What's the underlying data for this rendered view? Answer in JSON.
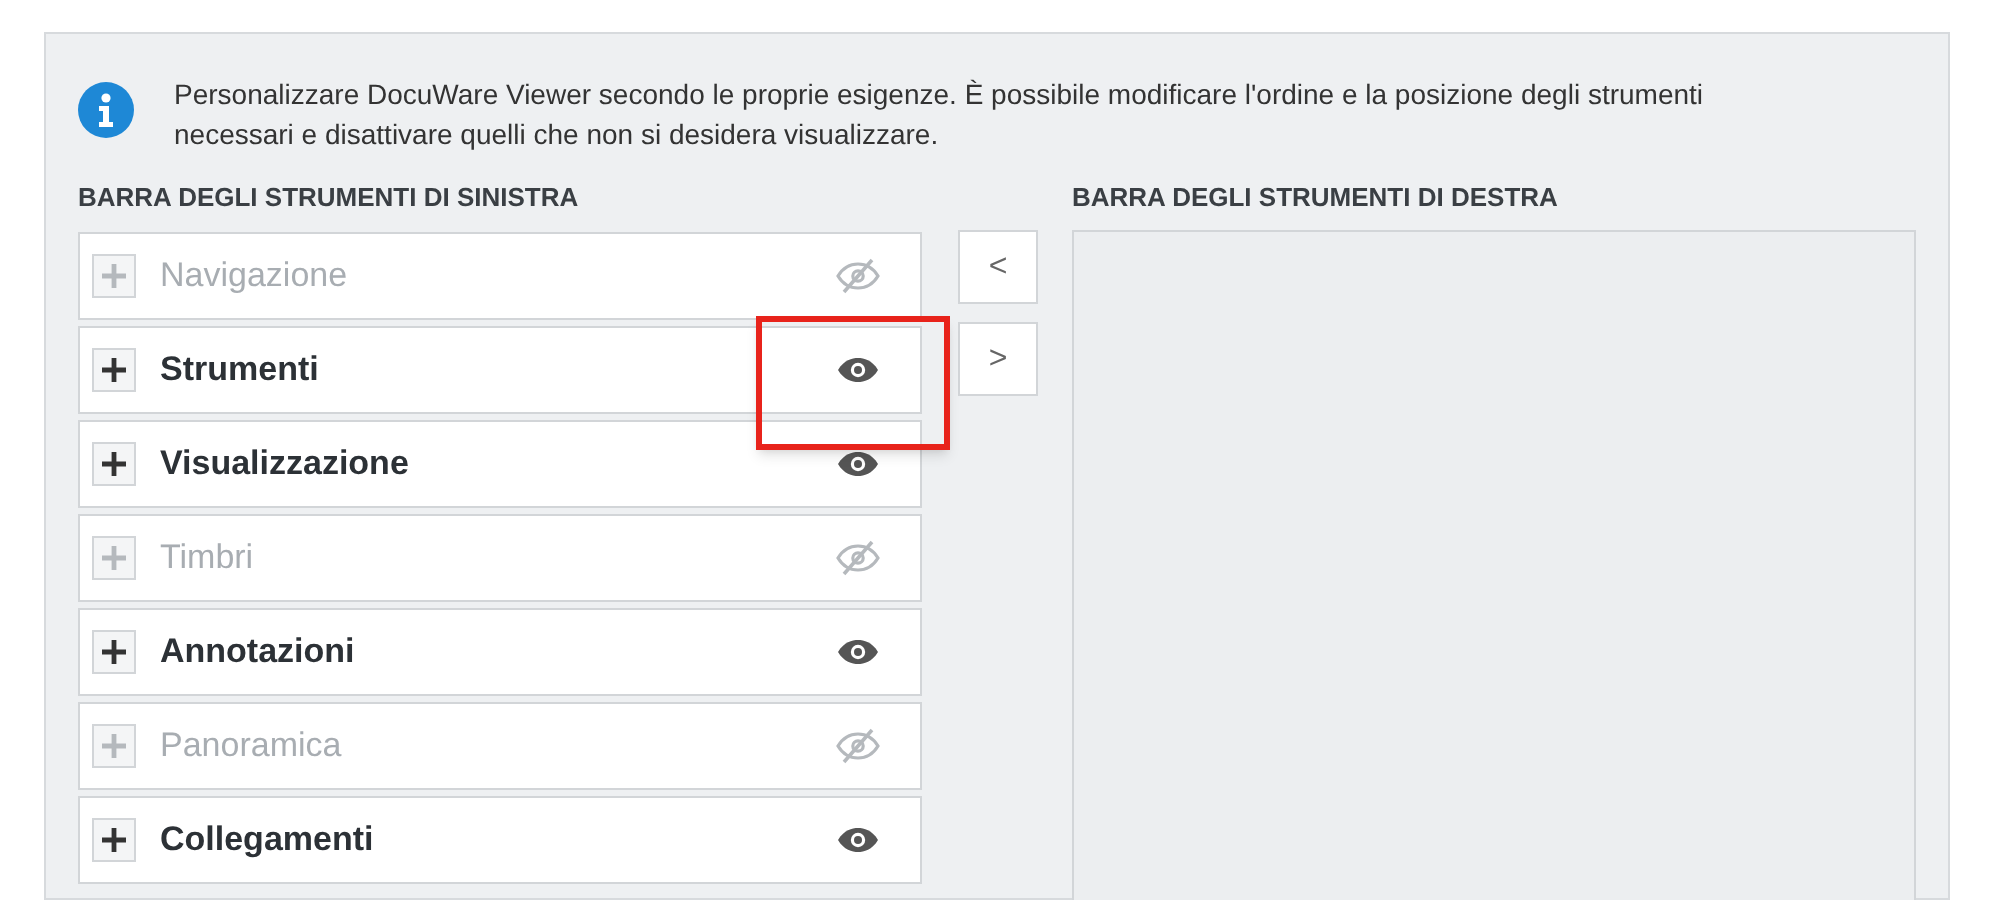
{
  "info": {
    "text": "Personalizzare DocuWare Viewer secondo le proprie esigenze. È possibile modificare l'ordine e la posizione degli strumenti necessari e disattivare quelli che non si desidera visualizzare."
  },
  "left_toolbar": {
    "heading": "BARRA DEGLI STRUMENTI DI SINISTRA",
    "items": [
      {
        "label": "Navigazione",
        "visible": false,
        "highlighted": false
      },
      {
        "label": "Strumenti",
        "visible": true,
        "highlighted": true
      },
      {
        "label": "Visualizzazione",
        "visible": true,
        "highlighted": false
      },
      {
        "label": "Timbri",
        "visible": false,
        "highlighted": false
      },
      {
        "label": "Annotazioni",
        "visible": true,
        "highlighted": false
      },
      {
        "label": "Panoramica",
        "visible": false,
        "highlighted": false
      },
      {
        "label": "Collegamenti",
        "visible": true,
        "highlighted": false
      }
    ]
  },
  "move_buttons": [
    {
      "label": "<"
    },
    {
      "label": ">"
    }
  ],
  "right_toolbar": {
    "heading": "BARRA DEGLI STRUMENTI DI DESTRA"
  }
}
